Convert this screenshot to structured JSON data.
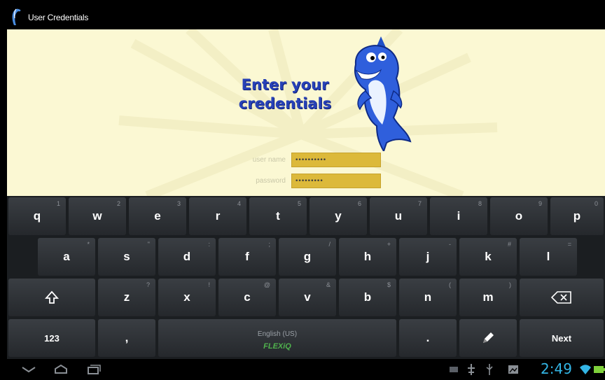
{
  "window": {
    "title": "User Credentials"
  },
  "content": {
    "heading_line1": "Enter your",
    "heading_line2": "credentials",
    "username_label": "user name",
    "username_value": "••••••••••",
    "password_label": "password",
    "password_value": "•••••••••"
  },
  "keyboard": {
    "row1": [
      {
        "label": "q",
        "sub": "1"
      },
      {
        "label": "w",
        "sub": "2"
      },
      {
        "label": "e",
        "sub": "3"
      },
      {
        "label": "r",
        "sub": "4"
      },
      {
        "label": "t",
        "sub": "5"
      },
      {
        "label": "y",
        "sub": "6"
      },
      {
        "label": "u",
        "sub": "7"
      },
      {
        "label": "i",
        "sub": "8"
      },
      {
        "label": "o",
        "sub": "9"
      },
      {
        "label": "p",
        "sub": "0"
      }
    ],
    "row2": [
      {
        "label": "a",
        "sub": "*"
      },
      {
        "label": "s",
        "sub": "\""
      },
      {
        "label": "d",
        "sub": ":"
      },
      {
        "label": "f",
        "sub": ";"
      },
      {
        "label": "g",
        "sub": "/"
      },
      {
        "label": "h",
        "sub": "+"
      },
      {
        "label": "j",
        "sub": "-"
      },
      {
        "label": "k",
        "sub": "#"
      },
      {
        "label": "l",
        "sub": "="
      }
    ],
    "row3": [
      {
        "label": "z",
        "sub": "?"
      },
      {
        "label": "x",
        "sub": "!"
      },
      {
        "label": "c",
        "sub": "@"
      },
      {
        "label": "v",
        "sub": "&"
      },
      {
        "label": "b",
        "sub": "$"
      },
      {
        "label": "n",
        "sub": "("
      },
      {
        "label": "m",
        "sub": ")"
      }
    ],
    "mode_label": "123",
    "comma_label": ",",
    "space_lang": "English (US)",
    "space_brand": "FLEXiQ",
    "period_label": ".",
    "next_label": "Next",
    "shift_icon": "shift-icon",
    "backspace_icon": "backspace-icon",
    "voice_icon": "pen-icon"
  },
  "status": {
    "time": "2:49"
  },
  "colors": {
    "background": "#fbf8d3",
    "field": "#dcb93a",
    "heading": "#2741b7",
    "clock": "#33b5e5"
  }
}
